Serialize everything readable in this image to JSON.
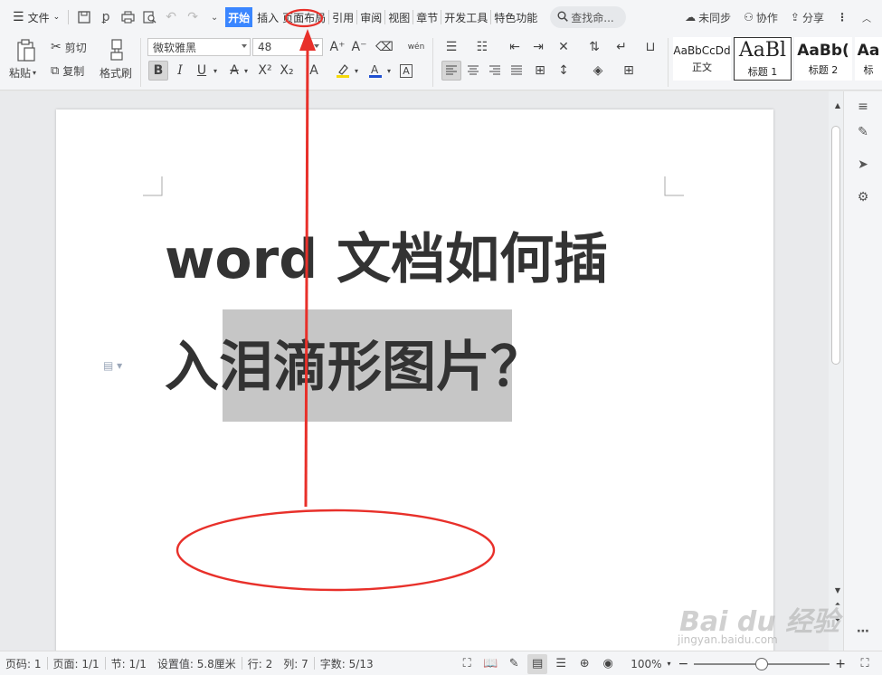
{
  "menubar": {
    "menu_label": "文件",
    "tabs": [
      "开始",
      "插入",
      "页面布局",
      "引用",
      "审阅",
      "视图",
      "章节",
      "开发工具",
      "特色功能"
    ],
    "active_tab": "开始",
    "search_placeholder": "查找命...",
    "sync_label": "未同步",
    "collab_label": "协作",
    "share_label": "分享"
  },
  "ribbon": {
    "clipboard": {
      "paste_label": "粘贴",
      "cut_label": "剪切",
      "copy_label": "复制",
      "format_painter_label": "格式刷"
    },
    "font": {
      "font_name": "微软雅黑",
      "font_size": "48"
    },
    "styles": [
      {
        "sample": "AaBbCcDd",
        "name": "正文"
      },
      {
        "sample": "AaBl",
        "name": "标题 1"
      },
      {
        "sample": "AaBb(",
        "name": "标题 2"
      },
      {
        "sample": "Aa",
        "name": "标"
      }
    ],
    "selected_style": "标题 1"
  },
  "document": {
    "line1": "word 文档如何插",
    "line2": "入泪滴形图片？"
  },
  "statusbar": {
    "page_no": "页码: 1",
    "pages": "页面: 1/1",
    "section": "节: 1/1",
    "setting": "设置值: 5.8厘米",
    "row": "行: 2",
    "col": "列: 7",
    "word_count": "字数: 5/13",
    "zoom": "100%",
    "zoom_level": 0.5
  },
  "watermark": {
    "text": "Bai du 经验",
    "url": "jingyan.baidu.com"
  },
  "colors": {
    "accent": "#3a86ff",
    "annotation": "#e8302a",
    "selection": "#c6c6c6"
  }
}
